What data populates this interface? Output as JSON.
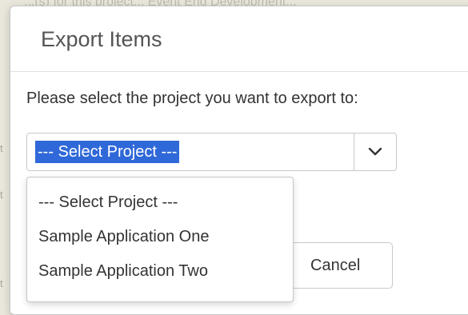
{
  "background": {
    "text": "...(s) for this project... Event End Development..."
  },
  "modal": {
    "title": "Export Items",
    "prompt": "Please select the project you want to export to:",
    "select": {
      "selected": "--- Select Project ---",
      "options": [
        "--- Select Project ---",
        "Sample Application One",
        "Sample Application Two"
      ]
    },
    "cancel_label": "Cancel"
  },
  "colors": {
    "selection_highlight": "#2f68d8",
    "text": "#333333",
    "title": "#555555",
    "border": "#c8c8c8"
  },
  "icons": {
    "select_arrow": "chevron-down-icon"
  }
}
